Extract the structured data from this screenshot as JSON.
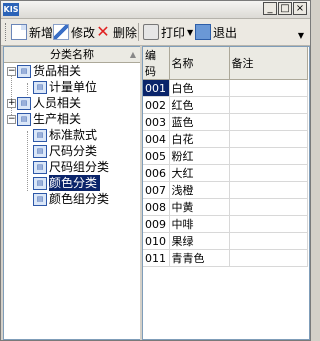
{
  "window": {
    "app_badge": "KIS"
  },
  "toolbar": {
    "new_label": "新增",
    "edit_label": "修改",
    "delete_label": "删除",
    "print_label": "打印",
    "exit_label": "退出"
  },
  "tree": {
    "header": "分类名称",
    "nodes": [
      {
        "label": "货品相关",
        "expander": "−"
      },
      {
        "label": "计量单位"
      },
      {
        "label": "人员相关",
        "expander": "+"
      },
      {
        "label": "生产相关",
        "expander": "−"
      },
      {
        "label": "标准款式"
      },
      {
        "label": "尺码分类"
      },
      {
        "label": "尺码组分类"
      },
      {
        "label": "颜色分类",
        "selected": true
      },
      {
        "label": "颜色组分类"
      }
    ]
  },
  "grid": {
    "columns": [
      "编码",
      "名称",
      "备注"
    ],
    "rows": [
      {
        "code": "001",
        "name": "白色",
        "note": ""
      },
      {
        "code": "002",
        "name": "红色",
        "note": ""
      },
      {
        "code": "003",
        "name": "蓝色",
        "note": ""
      },
      {
        "code": "004",
        "name": "白花",
        "note": ""
      },
      {
        "code": "005",
        "name": "粉红",
        "note": ""
      },
      {
        "code": "006",
        "name": "大红",
        "note": ""
      },
      {
        "code": "007",
        "name": "浅橙",
        "note": ""
      },
      {
        "code": "008",
        "name": "中黄",
        "note": ""
      },
      {
        "code": "009",
        "name": "中啡",
        "note": ""
      },
      {
        "code": "010",
        "name": "果绿",
        "note": ""
      },
      {
        "code": "011",
        "name": "青青色",
        "note": ""
      }
    ]
  }
}
